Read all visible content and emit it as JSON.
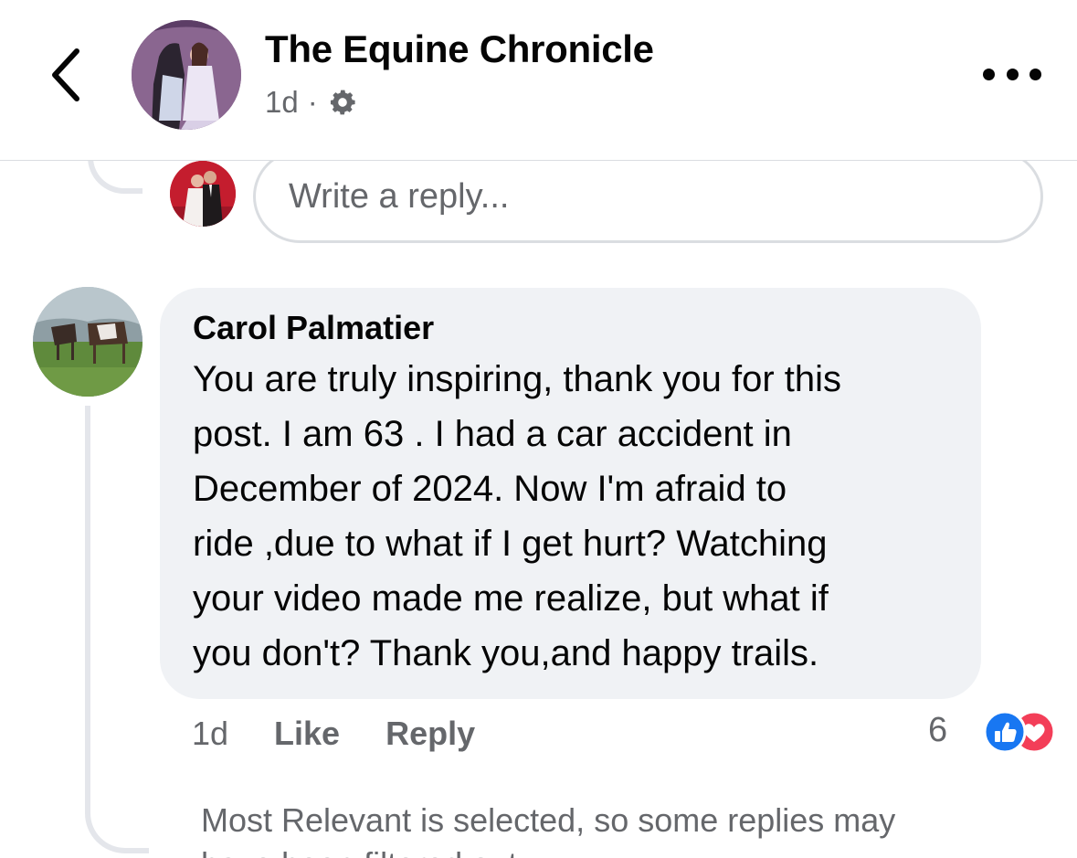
{
  "header": {
    "page_name": "The Equine Chronicle",
    "time": "1d",
    "separator": "·",
    "audience_icon": "gear-icon"
  },
  "composer": {
    "placeholder": "Write a reply..."
  },
  "comment": {
    "author": "Carol Palmatier",
    "text": "You are truly inspiring, thank you for this\npost. I am 63 . I had a car accident in\nDecember of 2024. Now I'm afraid to\nride ,due to what if I get hurt? Watching\nyour video made me realize,  but what if\nyou don't? Thank you,and happy trails.",
    "time": "1d",
    "like_label": "Like",
    "reply_label": "Reply",
    "reaction_count": "6",
    "reaction_types": [
      "like",
      "love"
    ]
  },
  "footer": {
    "filter_note": "Most Relevant is selected, so some replies may\nhave been filtered out."
  },
  "colors": {
    "like_blue": "#1877f2",
    "love_red": "#f33e58",
    "bubble_bg": "#f0f2f5",
    "secondary_text": "#65676b"
  }
}
